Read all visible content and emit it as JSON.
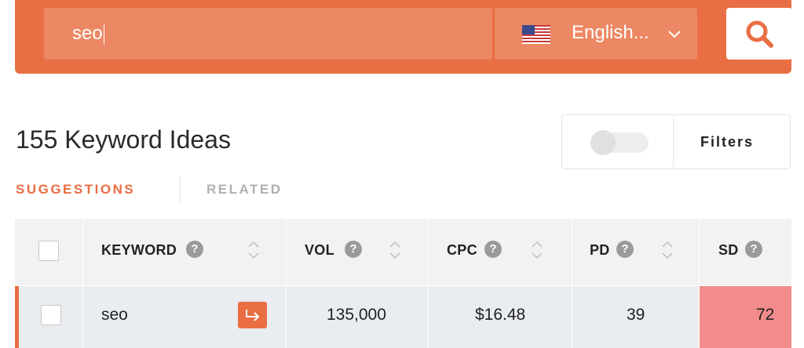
{
  "search": {
    "value": "seo"
  },
  "language": {
    "label": "English..."
  },
  "results": {
    "title": "155 Keyword Ideas"
  },
  "filters": {
    "label": "Filters"
  },
  "tabs": [
    {
      "label": "SUGGESTIONS"
    },
    {
      "label": "RELATED"
    }
  ],
  "table": {
    "columns": [
      {
        "label": "KEYWORD"
      },
      {
        "label": "VOL"
      },
      {
        "label": "CPC"
      },
      {
        "label": "PD"
      },
      {
        "label": "SD"
      }
    ],
    "rows": [
      {
        "keyword": "seo",
        "vol": "135,000",
        "cpc": "$16.48",
        "pd": "39",
        "sd": "72"
      }
    ]
  },
  "colors": {
    "accent": "#e96e43",
    "sd_high": "#f28c8c",
    "row_bg": "#e9ecf0",
    "header_bg": "#f2f2f2"
  }
}
